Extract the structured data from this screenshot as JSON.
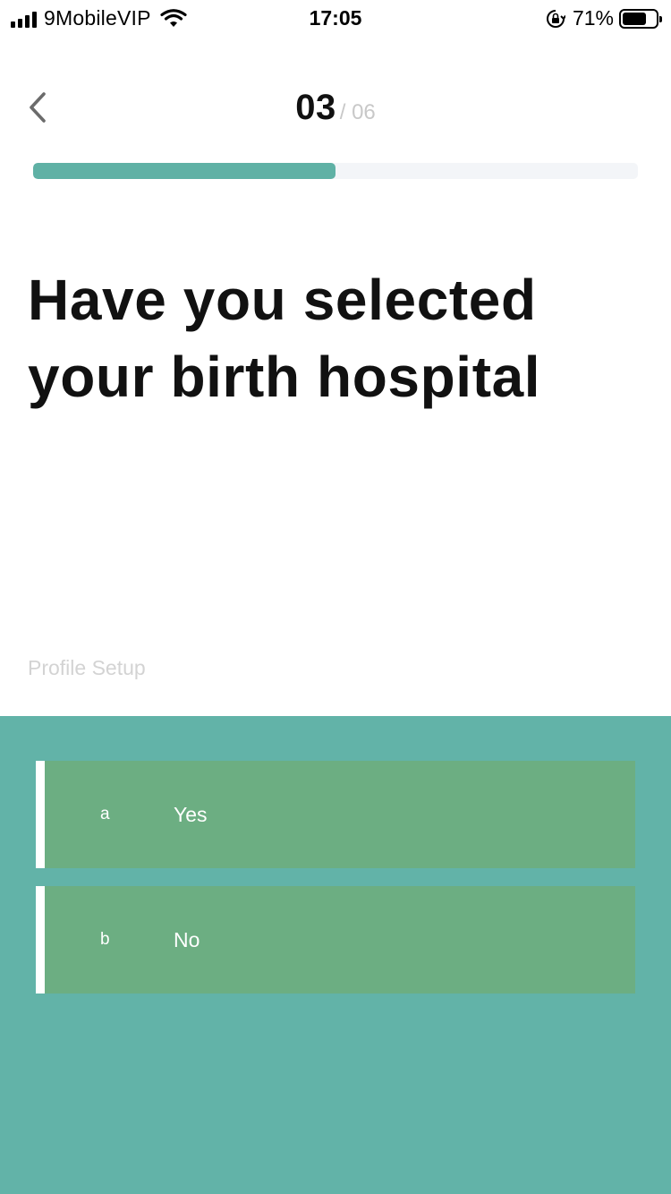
{
  "status_bar": {
    "carrier": "9MobileVIP",
    "time": "17:05",
    "battery_percent": "71%",
    "battery_level": 0.71,
    "icons": [
      "signal-icon",
      "wifi-icon",
      "orientation-lock-icon",
      "battery-icon"
    ]
  },
  "header": {
    "back_icon": "chevron-left-icon",
    "step_current": "03",
    "step_total": "/ 06"
  },
  "progress": {
    "fraction": 0.5
  },
  "question": {
    "title": "Have you selected your birth hospital"
  },
  "section_label": "Profile Setup",
  "options": [
    {
      "letter": "a",
      "label": "Yes"
    },
    {
      "letter": "b",
      "label": "No"
    }
  ],
  "colors": {
    "accent": "#5fb1a5",
    "panel": "#62b3a8",
    "option": "#6cae82",
    "text": "#111111"
  }
}
